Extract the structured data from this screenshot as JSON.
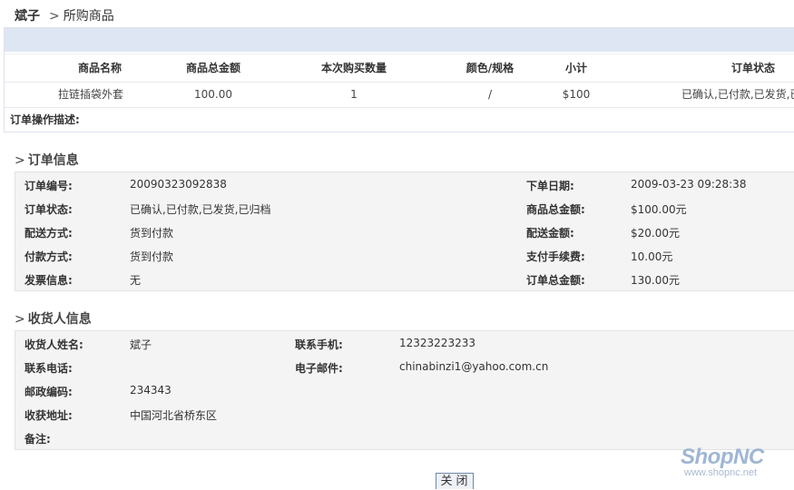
{
  "breadcrumb": {
    "user": "斌子",
    "separator": ">",
    "page": "所购商品"
  },
  "goods_table": {
    "headers": [
      "商品名称",
      "商品总金额",
      "本次购买数量",
      "颜色/规格",
      "小计",
      "订单状态"
    ],
    "rows": [
      [
        "拉链插袋外套",
        "100.00",
        "1",
        "/",
        "$100",
        "已确认,已付款,已发货,已"
      ]
    ],
    "operation_label": "订单操作描述:"
  },
  "order_info": {
    "title": "订单信息",
    "fields": [
      {
        "label": "订单编号:",
        "value": "20090323092838"
      },
      {
        "label": "订单状态:",
        "value": "已确认,已付款,已发货,已归档"
      },
      {
        "label": "配送方式:",
        "value": "货到付款"
      },
      {
        "label": "付款方式:",
        "value": "货到付款"
      },
      {
        "label": "发票信息:",
        "value": "无"
      }
    ],
    "fields_right": [
      {
        "label": "下单日期:",
        "value": "2009-03-23 09:28:38"
      },
      {
        "label": "商品总金额:",
        "value": "$100.00元"
      },
      {
        "label": "配送金额:",
        "value": "$20.00元"
      },
      {
        "label": "支付手续费:",
        "value": "10.00元"
      },
      {
        "label": "订单总金额:",
        "value": "130.00元"
      }
    ]
  },
  "consignee_info": {
    "title": "收货人信息",
    "fields": [
      {
        "label": "收货人姓名:",
        "value": "斌子"
      },
      {
        "label": "联系电话:",
        "value": ""
      },
      {
        "label": "邮政编码:",
        "value": "234343"
      },
      {
        "label": "收获地址:",
        "value": "中国河北省桥东区"
      },
      {
        "label": "备注:",
        "value": ""
      }
    ],
    "fields_right": [
      {
        "label": "联系手机:",
        "value": "12323223233"
      },
      {
        "label": "电子邮件:",
        "value": "chinabinzi1@yahoo.com.cn"
      }
    ]
  },
  "logo": {
    "brand": "ShopNC",
    "url": "www.shopnc.net"
  },
  "close_button": {
    "label": "关闭"
  },
  "colors": {
    "band": "#dfe6f3",
    "panel": "#f4f4f4",
    "logo": "#9fb6d3"
  }
}
